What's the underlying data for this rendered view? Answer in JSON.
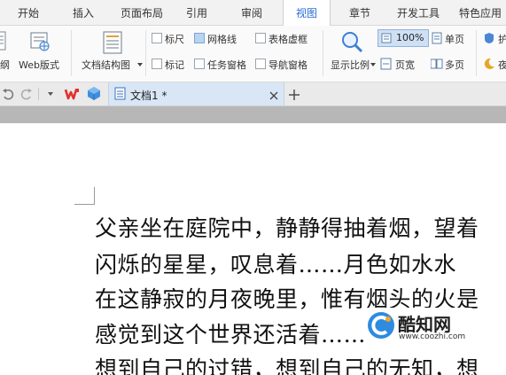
{
  "menu": {
    "tabs": [
      {
        "label": "开始",
        "active": false
      },
      {
        "label": "插入",
        "active": false
      },
      {
        "label": "页面布局",
        "active": false
      },
      {
        "label": "引用",
        "active": false
      },
      {
        "label": "审阅",
        "active": false
      },
      {
        "label": "视图",
        "active": true
      },
      {
        "label": "章节",
        "active": false
      },
      {
        "label": "开发工具",
        "active": false
      },
      {
        "label": "特色应用",
        "active": false
      }
    ]
  },
  "ribbon": {
    "partial_left_label": "纲",
    "web_layout_label": "Web版式",
    "doc_structure_label": "文档结构图",
    "checkboxes": {
      "ruler": {
        "label": "标尺",
        "checked": false
      },
      "gridlines": {
        "label": "网格线",
        "checked": true
      },
      "table_gridlines": {
        "label": "表格虚框",
        "checked": false
      },
      "marks": {
        "label": "标记",
        "checked": false
      },
      "task_pane": {
        "label": "任务窗格",
        "checked": false
      },
      "nav_pane": {
        "label": "导航窗格",
        "checked": false
      }
    },
    "zoom_label": "显示比例",
    "zoom_value": "100%",
    "page_width_label": "页宽",
    "single_page_label": "单页",
    "multi_page_label": "多页",
    "partial_right_top": "护",
    "partial_right_bottom": "夜"
  },
  "tabs": {
    "document": {
      "label": "文档1 *"
    }
  },
  "document": {
    "lines": [
      "父亲坐在庭院中，静静得抽着烟，望着",
      "闪烁的星星，叹息着……月色如水水",
      "在这静寂的月夜晚里，惟有烟头的火是",
      "感觉到这个世界还活着……",
      "想到自己的过错，想到自己的无知，想"
    ]
  },
  "watermark": {
    "name": "酷知网",
    "url": "www.coozhi.com"
  },
  "colors": {
    "accent": "#2a6ed1",
    "wps_red": "#e0322e",
    "tab_active_bg": "#d8e6f6"
  }
}
